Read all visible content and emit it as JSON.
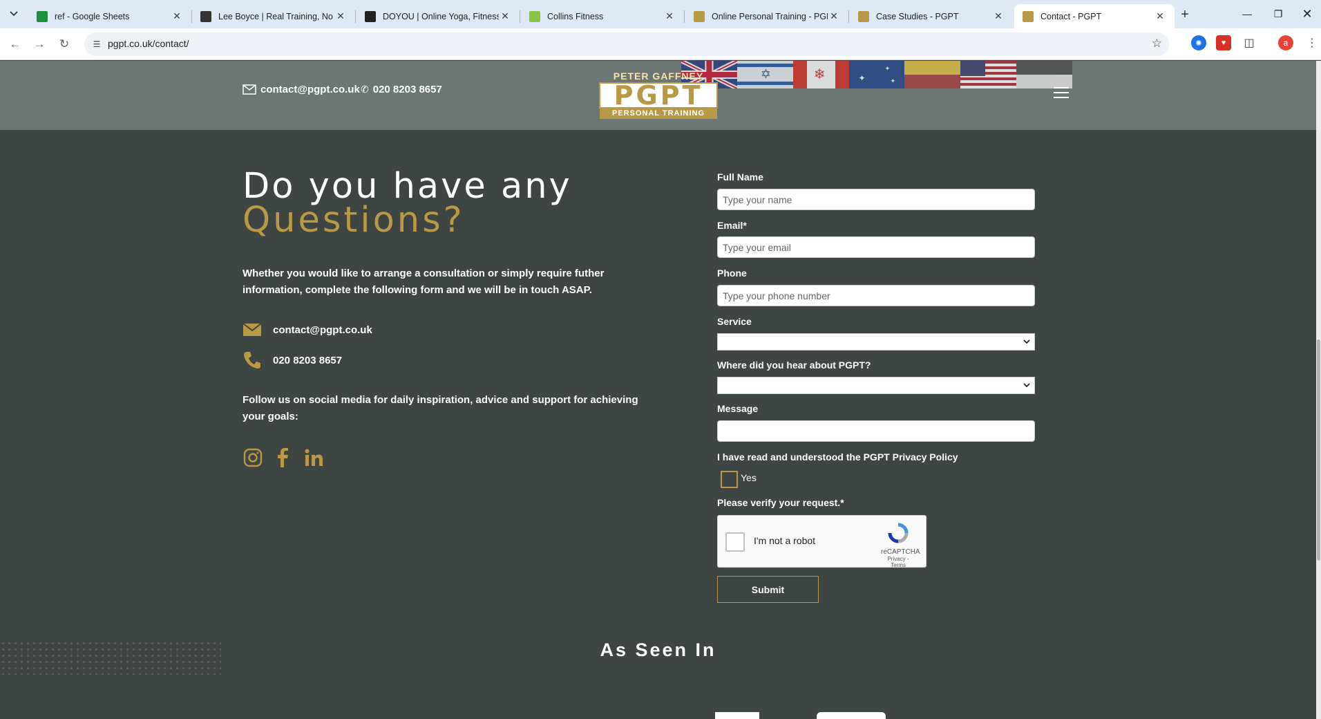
{
  "browser": {
    "tabs": [
      {
        "title": "ref - Google Sheets",
        "favicon": "google-sheets-icon",
        "color": "#1e8e3e"
      },
      {
        "title": "Lee Boyce | Real Training, No N",
        "favicon": "person-icon",
        "color": "#333333"
      },
      {
        "title": "DOYOU | Online Yoga, Fitness, &",
        "favicon": "circle-icon",
        "color": "#222222"
      },
      {
        "title": "Collins Fitness",
        "favicon": "square-icon",
        "color": "#8bc34a"
      },
      {
        "title": "Online Personal Training - PGPT",
        "favicon": "pgpt-icon",
        "color": "#b89a46"
      },
      {
        "title": "Case Studies - PGPT",
        "favicon": "pgpt-icon",
        "color": "#b89a46"
      },
      {
        "title": "Contact - PGPT",
        "favicon": "pgpt-icon",
        "color": "#b89a46"
      }
    ],
    "url": "pgpt.co.uk/contact/",
    "profile_initial": "a"
  },
  "header": {
    "email": "contact@pgpt.co.uk",
    "phone": "020 8203 8657",
    "logo": {
      "top": "PETER GAFFNEY",
      "main": "PGPT",
      "bottom": "PERSONAL TRAINING"
    }
  },
  "contact": {
    "heading_line1": "Do you have any",
    "heading_line2": "Questions?",
    "intro": "Whether you would like to arrange a consultation or simply require futher information, complete the following form and we will be in touch ASAP.",
    "email": "contact@pgpt.co.uk",
    "phone": "020 8203 8657",
    "follow": "Follow us on social media for daily inspiration, advice and support for achieving your goals:"
  },
  "form": {
    "full_name_label": "Full Name",
    "full_name_placeholder": "Type your name",
    "email_label": "Email*",
    "email_placeholder": "Type your email",
    "phone_label": "Phone",
    "phone_placeholder": "Type your phone number",
    "service_label": "Service",
    "hear_label": "Where did you hear about PGPT?",
    "message_label": "Message",
    "privacy_label": "I have read and understood the PGPT Privacy Policy",
    "privacy_option": "Yes",
    "verify_label": "Please verify your request.*",
    "recaptcha_text": "I'm not a robot",
    "recaptcha_brand": "reCAPTCHA",
    "recaptcha_links": "Privacy - Terms",
    "submit_label": "Submit"
  },
  "as_seen_in": "As Seen In",
  "colors": {
    "accent_gold": "#b89a46",
    "background": "#3f4542",
    "header_bg": "#6d7672"
  }
}
